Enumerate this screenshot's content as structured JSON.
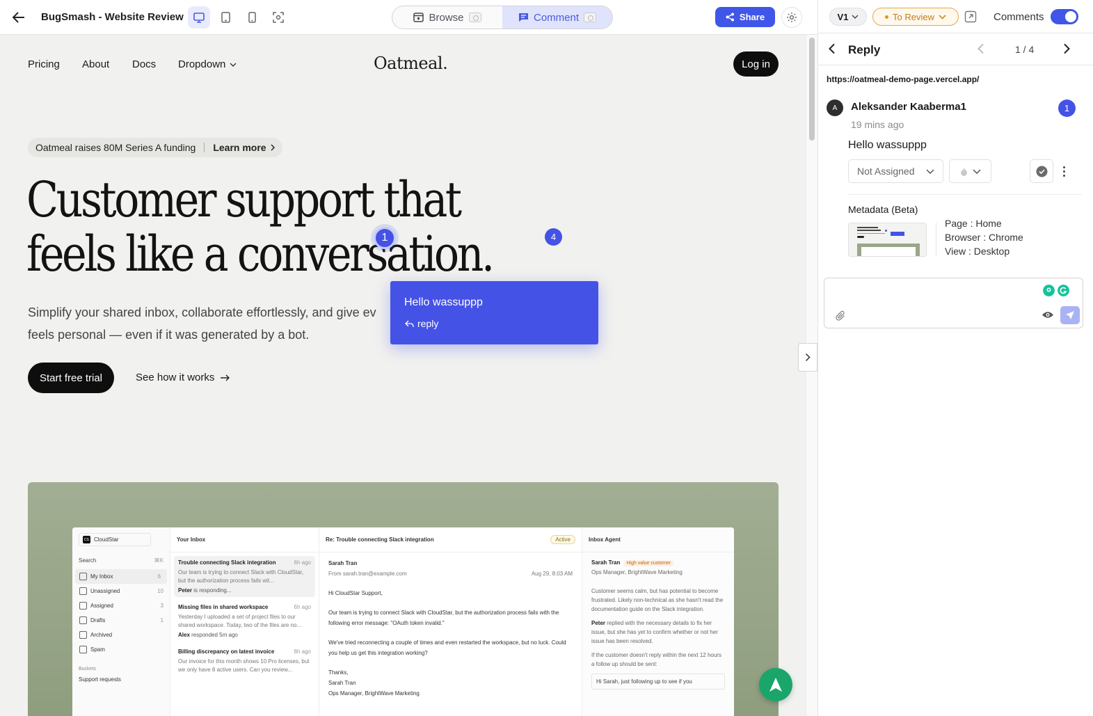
{
  "topbar": {
    "title": "BugSmash - Website Review",
    "devices": [
      "desktop-icon",
      "tablet-icon",
      "mobile-icon",
      "screenshot-icon"
    ],
    "modes": [
      {
        "label": "Browse",
        "active": false
      },
      {
        "label": "Comment",
        "active": true
      }
    ],
    "share_label": "Share"
  },
  "site": {
    "nav": [
      "Pricing",
      "About",
      "Docs",
      "Dropdown"
    ],
    "logo": "Oatmeal.",
    "login_label": "Log in",
    "announcement": "Oatmeal raises 80M Series A funding",
    "announcement_link": "Learn more",
    "headline_line1": "Customer support that",
    "headline_line2": "feels like a conversation.",
    "subtext_line1": "Simplify your shared inbox, collaborate effortlessly, and give ev",
    "subtext_line2": "feels personal — even if it was generated by a bot.",
    "cta_primary": "Start free trial",
    "cta_secondary": "See how it works"
  },
  "pins": [
    {
      "number": "1",
      "active": true
    },
    {
      "number": "4",
      "active": false
    }
  ],
  "popup": {
    "message": "Hello wassuppp",
    "reply_label": "reply"
  },
  "mock_app": {
    "workspace": "CloudStar",
    "search_label": "Search",
    "search_shortcut": "⌘K",
    "nav": [
      {
        "label": "My Inbox",
        "count": "6"
      },
      {
        "label": "Unassigned",
        "count": "10"
      },
      {
        "label": "Assigned",
        "count": "3"
      },
      {
        "label": "Drafts",
        "count": "1"
      },
      {
        "label": "Archived",
        "count": ""
      },
      {
        "label": "Spam",
        "count": ""
      }
    ],
    "buckets_label": "Buckets",
    "bucket_item": "Support requests",
    "inbox_title": "Your Inbox",
    "inbox_items": [
      {
        "title": "Trouble connecting Slack integration",
        "time": "6h ago",
        "preview": "Our team is trying to connect Slack with CloudStar, but the authorization process fails wit...",
        "status_name": "Peter",
        "status_text": "is responding..."
      },
      {
        "title": "Missing files in shared workspace",
        "time": "6h ago",
        "preview": "Yesterday I uploaded a set of project files to our shared workspace. Today, two of the files are no...",
        "status_name": "Alex",
        "status_text": "responded 5m ago"
      },
      {
        "title": "Billing discrepancy on latest invoice",
        "time": "8h ago",
        "preview": "Our invoice for this month shows 10 Pro licenses, but we only have 8 active users. Can you review...",
        "status_name": "",
        "status_text": ""
      }
    ],
    "thread_subject": "Re: Trouble connecting Slack integration",
    "thread_status": "Active",
    "thread_sender": "Sarah Tran",
    "thread_from_label": "From",
    "thread_email": "sarah.tran@example.com",
    "thread_date": "Aug 29, 8:03 AM",
    "thread_greeting": "Hi CloudStar Support,",
    "thread_p1": "Our team is trying to connect Slack with CloudStar, but the authorization process fails with the following error message: \"OAuth token invalid.\"",
    "thread_p2": "We've tried reconnecting a couple of times and even restarted the workspace, but no luck. Could you help us get this integration working?",
    "thread_signoff": "Thanks,",
    "thread_sig_name": "Sarah Tran",
    "thread_sig_title": "Ops Manager, BrightWave Marketing",
    "agent_title": "Inbox Agent",
    "agent_customer": "Sarah Tran",
    "agent_badge": "High value customer",
    "agent_role": "Ops Manager, BrightWave Marketing",
    "agent_p1": "Customer seems calm, but has potential to become frustrated. Likely non-technical as she hasn't read the documentation guide on the Slack integration.",
    "agent_p2_name": "Peter",
    "agent_p2": "replied with the necessary details to fix her issue, but she has yet to confirm whether or not her issue has been resolved.",
    "agent_p3": "If the customer doesn't reply within the next 12 hours a follow up should be sent:",
    "agent_quote": "Hi Sarah, just following up to see if you"
  },
  "panel": {
    "version": "V1",
    "status": "To Review",
    "comments_label": "Comments",
    "comments_enabled": true,
    "header_title": "Reply",
    "pager": "1 / 4",
    "url": "https://oatmeal-demo-page.vercel.app/",
    "avatar_initial": "A",
    "author": "Aleksander Kaaberma1",
    "pin_number": "1",
    "time": "19 mins ago",
    "message": "Hello wassuppp",
    "assignee": "Not Assigned",
    "metadata_title": "Metadata (Beta)",
    "metadata": [
      "Page : Home",
      "Browser : Chrome",
      "View : Desktop"
    ],
    "composer_value": ""
  },
  "colors": {
    "accent": "#4552e6",
    "share": "#4056e8",
    "status": "#e39223",
    "fab": "#1aa56b"
  }
}
